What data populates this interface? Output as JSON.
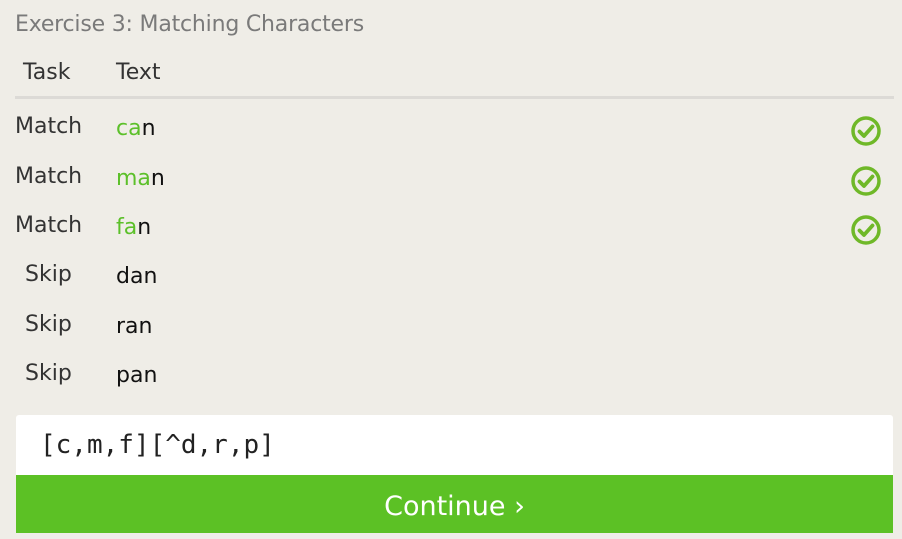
{
  "exercise": {
    "title": "Exercise 3: Matching Characters"
  },
  "table": {
    "headers": {
      "task": "Task",
      "text": "Text"
    },
    "rows": [
      {
        "task": "Match",
        "highlight": "ca",
        "rest": "n",
        "status": "check-icon"
      },
      {
        "task": "Match",
        "highlight": "ma",
        "rest": "n",
        "status": "check-icon"
      },
      {
        "task": "Match",
        "highlight": "fa",
        "rest": "n",
        "status": "check-icon"
      },
      {
        "task": "Skip",
        "highlight": "",
        "rest": "dan",
        "status": ""
      },
      {
        "task": "Skip",
        "highlight": "",
        "rest": "ran",
        "status": ""
      },
      {
        "task": "Skip",
        "highlight": "",
        "rest": "pan",
        "status": ""
      }
    ]
  },
  "regex_input": {
    "value": "[c,m,f][^d,r,p]"
  },
  "continue_button": {
    "label": "Continue ›"
  },
  "colors": {
    "accent": "#5cc125",
    "highlight": "#5cc02a",
    "check": "#6fb828"
  }
}
